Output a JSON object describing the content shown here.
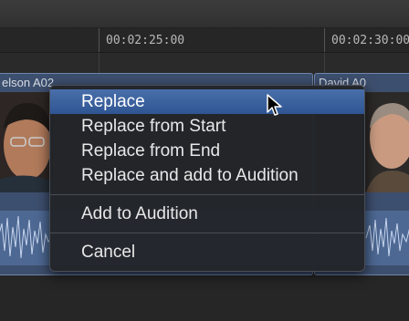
{
  "ruler": {
    "tick_1": "00:02:25:00",
    "tick_2": "00:02:30:00"
  },
  "clips": {
    "left_title": "elson A02",
    "right_title": "David A0"
  },
  "menu": {
    "items": [
      {
        "label": "Replace",
        "selected": true
      },
      {
        "label": "Replace from Start",
        "selected": false
      },
      {
        "label": "Replace from End",
        "selected": false
      },
      {
        "label": "Replace and add to Audition",
        "selected": false
      },
      {
        "label": "Add to Audition",
        "selected": false
      },
      {
        "label": "Cancel",
        "selected": false
      }
    ]
  },
  "colors": {
    "selection": "#3a62a3",
    "menu_background": "#222429",
    "clip_blue": "#3d4f6e"
  },
  "icons": {
    "cursor": "arrow-pointer-icon"
  }
}
